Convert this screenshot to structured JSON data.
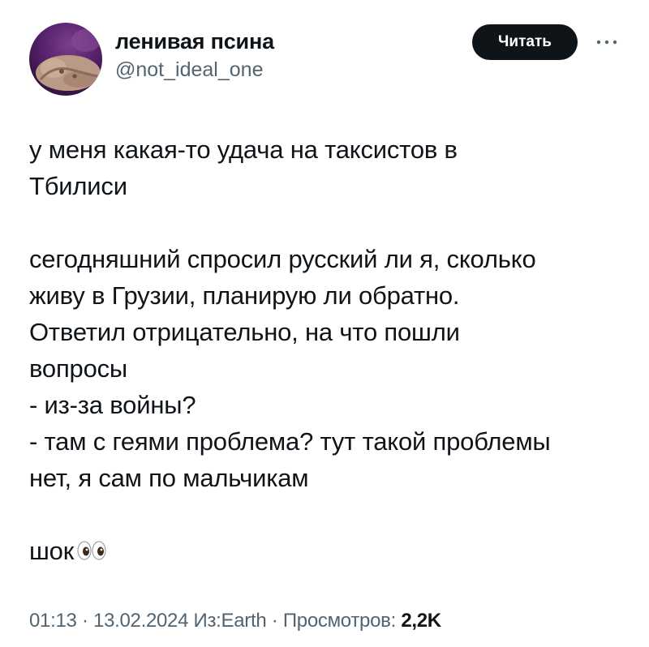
{
  "author": {
    "display_name": "ленивая псина",
    "handle": "@not_ideal_one",
    "avatar_icon": "avatar-photo"
  },
  "actions": {
    "follow_label": "Читать",
    "more_icon": "more-dots-icon"
  },
  "tweet": {
    "paragraphs": [
      [
        "у меня какая-то удача на таксистов в",
        "Тбилиси"
      ],
      [
        "сегодняшний спросил русский ли я, сколько",
        "живу в Грузии, планирую ли обратно.",
        "Ответил отрицательно, на что пошли",
        "вопросы",
        "- из-за войны?",
        "- там с геями проблема? тут такой проблемы",
        "нет, я сам по мальчикам"
      ],
      [
        "шок"
      ]
    ],
    "emoji": "eyes-emoji"
  },
  "meta": {
    "time": "01:13",
    "separator": "·",
    "date": "13.02.2024",
    "source": "Из:Earth",
    "views_label": "Просмотров:",
    "views_count": "2,2K"
  },
  "colors": {
    "text_primary": "#0f1419",
    "text_secondary": "#536471",
    "button_bg": "#0f1419",
    "button_text": "#ffffff"
  }
}
